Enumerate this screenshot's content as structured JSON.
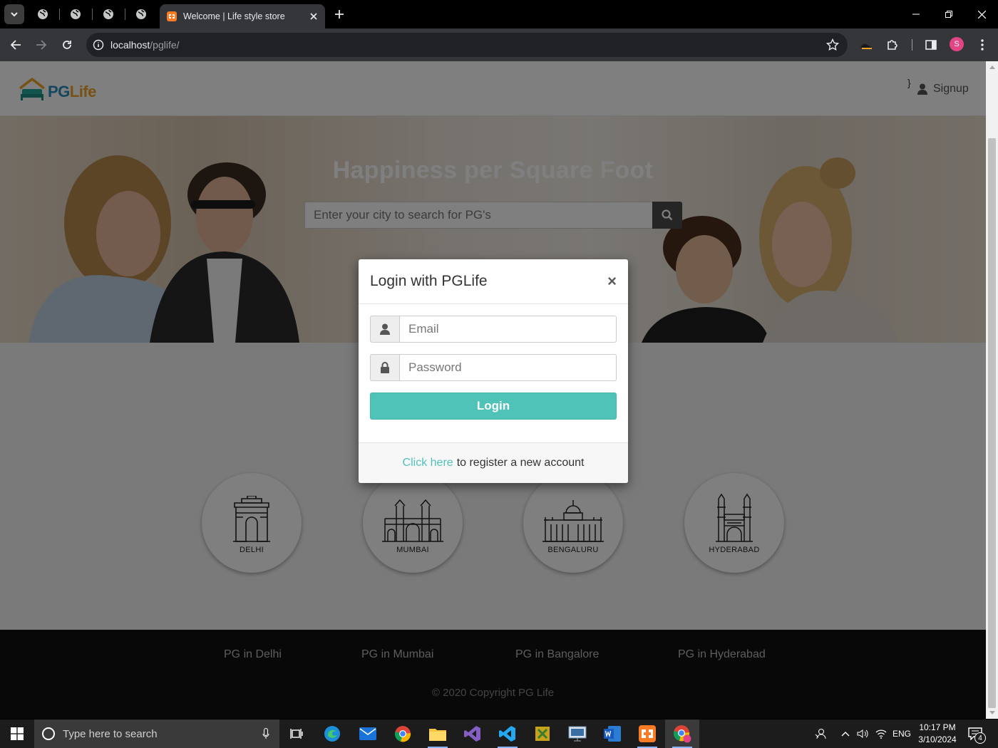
{
  "browser": {
    "tab_title": "Welcome | Life style store",
    "url_host": "localhost",
    "url_path": "/pglife/",
    "profile_initial": "S"
  },
  "site": {
    "logo": {
      "pg": "PG",
      "life": "Life"
    },
    "header_brace": "}",
    "signup_label": "Signup",
    "banner_title": "Happiness per Square Foot",
    "search_placeholder": "Enter your city to search for PG's",
    "cities": [
      {
        "name": "DELHI",
        "icon": "india-gate-icon"
      },
      {
        "name": "MUMBAI",
        "icon": "gateway-of-india-icon"
      },
      {
        "name": "BENGALURU",
        "icon": "vidhana-soudha-icon"
      },
      {
        "name": "HYDERABAD",
        "icon": "charminar-icon"
      }
    ],
    "footer_links": [
      "PG in Delhi",
      "PG in Mumbai",
      "PG in Bangalore",
      "PG in Hyderabad"
    ],
    "copyright": "© 2020 Copyright PG Life"
  },
  "modal": {
    "title": "Login with PGLife",
    "close": "×",
    "email_placeholder": "Email",
    "password_placeholder": "Password",
    "login_label": "Login",
    "footer_link": "Click here",
    "footer_text": "to register a new account"
  },
  "taskbar": {
    "search_placeholder": "Type here to search",
    "language": "ENG",
    "time": "10:17 PM",
    "date": "3/10/2024",
    "notification_count": "4"
  },
  "colors": {
    "accent": "#4fc3b8",
    "logo_pg": "#2b8cbe",
    "logo_life": "#f0a326",
    "overlay": "rgba(0,0,0,0.5)"
  }
}
